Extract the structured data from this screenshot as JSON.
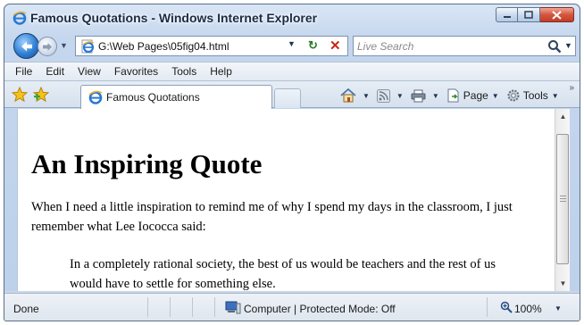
{
  "window": {
    "title": "Famous Quotations - Windows Internet Explorer"
  },
  "address": {
    "url": "G:\\Web Pages\\05fig04.html",
    "search_placeholder": "Live Search"
  },
  "menu": [
    "File",
    "Edit",
    "View",
    "Favorites",
    "Tools",
    "Help"
  ],
  "tab": {
    "label": "Famous Quotations"
  },
  "commands": {
    "page": "Page",
    "tools": "Tools"
  },
  "content": {
    "heading": "An Inspiring Quote",
    "paragraph": "When I need a little inspiration to remind me of why I spend my days in the classroom, I just remember what Lee Iococca said:",
    "quote": "In a completely rational society, the best of us would be teachers and the rest of us would have to settle for something else."
  },
  "status": {
    "text": "Done",
    "zone": "Computer | Protected Mode: Off",
    "zoom": "100%"
  },
  "colors": {
    "chrome": "#c5d7ee",
    "close_button": "#c23d27",
    "refresh": "#2c7a2c",
    "stop": "#c8261b"
  },
  "icons": [
    "ie-logo-icon",
    "back-arrow-icon",
    "forward-arrow-icon",
    "refresh-icon",
    "stop-icon",
    "search-icon",
    "favorites-star-icon",
    "add-favorites-icon",
    "home-icon",
    "feeds-icon",
    "print-icon",
    "page-icon",
    "tools-gear-icon",
    "computer-zone-icon",
    "zoom-icon"
  ]
}
